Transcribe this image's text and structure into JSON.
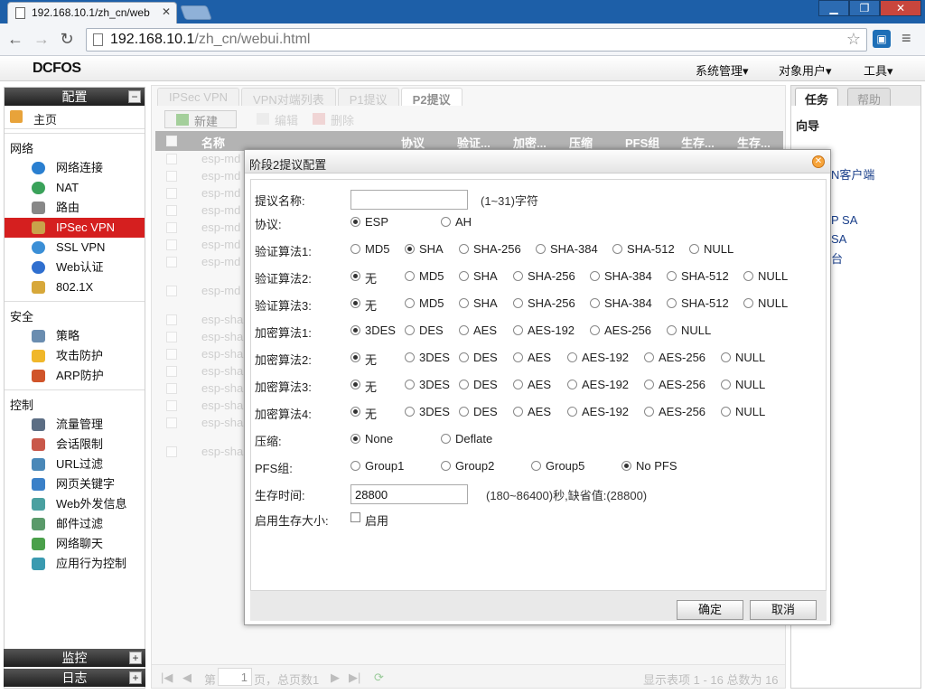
{
  "browser": {
    "tab_title": "192.168.10.1/zh_cn/web",
    "address_host": "192.168.10.1",
    "address_path": "/zh_cn/webui.html"
  },
  "app": {
    "logo": "DCFOS",
    "top_menu": [
      "系统管理▾",
      "对象用户▾",
      "工具▾"
    ]
  },
  "leftnav": {
    "header": "配置",
    "home": "主页",
    "sections": [
      {
        "title": "网络",
        "items": [
          "网络连接",
          "NAT",
          "路由",
          "IPSec VPN",
          "SSL VPN",
          "Web认证",
          "802.1X"
        ]
      },
      {
        "title": "安全",
        "items": [
          "策略",
          "攻击防护",
          "ARP防护"
        ]
      },
      {
        "title": "控制",
        "items": [
          "流量管理",
          "会话限制",
          "URL过滤",
          "网页关键字",
          "Web外发信息",
          "邮件过滤",
          "网络聊天",
          "应用行为控制"
        ]
      }
    ],
    "active_item": "IPSec VPN",
    "bottom": [
      "监控",
      "日志"
    ]
  },
  "main": {
    "tabs": [
      "IPSec VPN",
      "VPN对端列表",
      "P1提议",
      "P2提议"
    ],
    "active_tab": "P2提议",
    "actions": {
      "new": "新建",
      "edit": "编辑",
      "delete": "删除"
    },
    "columns": [
      "名称",
      "协议",
      "验证...",
      "加密...",
      "压缩",
      "PFS组",
      "生存...",
      "生存..."
    ],
    "rows": [
      "esp-md",
      "esp-md",
      "esp-md",
      "esp-md",
      "esp-md",
      "esp-md",
      "esp-md",
      "esp-md",
      "esp-sha",
      "esp-sha",
      "esp-sha",
      "esp-sha",
      "esp-sha",
      "esp-sha",
      "esp-sha",
      "esp-sha"
    ],
    "pager": {
      "prefix": "第",
      "page": "1",
      "suffix": "页，总页数1",
      "summary": "显示表项 1 - 16 总数为 16"
    }
  },
  "rightpanel": {
    "tabs": [
      "任务",
      "帮助"
    ],
    "title": "向导",
    "links": [
      "N客户端",
      "P SA",
      "SA",
      "台"
    ]
  },
  "dialog": {
    "title": "阶段2提议配置",
    "fields": {
      "name": {
        "label": "提议名称:",
        "value": "",
        "hint": "(1~31)字符"
      },
      "protocol": {
        "label": "协议:",
        "options": [
          "ESP",
          "AH"
        ],
        "selected": "ESP"
      },
      "auth1": {
        "label": "验证算法1:",
        "options": [
          "MD5",
          "SHA",
          "SHA-256",
          "SHA-384",
          "SHA-512",
          "NULL"
        ],
        "selected": "SHA"
      },
      "auth2": {
        "label": "验证算法2:",
        "options": [
          "无",
          "MD5",
          "SHA",
          "SHA-256",
          "SHA-384",
          "SHA-512",
          "NULL"
        ],
        "selected": "无"
      },
      "auth3": {
        "label": "验证算法3:",
        "options": [
          "无",
          "MD5",
          "SHA",
          "SHA-256",
          "SHA-384",
          "SHA-512",
          "NULL"
        ],
        "selected": "无"
      },
      "enc1": {
        "label": "加密算法1:",
        "options": [
          "3DES",
          "DES",
          "AES",
          "AES-192",
          "AES-256",
          "NULL"
        ],
        "selected": "3DES"
      },
      "enc2": {
        "label": "加密算法2:",
        "options": [
          "无",
          "3DES",
          "DES",
          "AES",
          "AES-192",
          "AES-256",
          "NULL"
        ],
        "selected": "无"
      },
      "enc3": {
        "label": "加密算法3:",
        "options": [
          "无",
          "3DES",
          "DES",
          "AES",
          "AES-192",
          "AES-256",
          "NULL"
        ],
        "selected": "无"
      },
      "enc4": {
        "label": "加密算法4:",
        "options": [
          "无",
          "3DES",
          "DES",
          "AES",
          "AES-192",
          "AES-256",
          "NULL"
        ],
        "selected": "无"
      },
      "compress": {
        "label": "压缩:",
        "options": [
          "None",
          "Deflate"
        ],
        "selected": "None"
      },
      "pfs": {
        "label": "PFS组:",
        "options": [
          "Group1",
          "Group2",
          "Group5",
          "No PFS"
        ],
        "selected": "No PFS"
      },
      "lifetime": {
        "label": "生存时间:",
        "value": "28800",
        "hint": "(180~86400)秒,缺省值:(28800)"
      },
      "lifesize": {
        "label": "启用生存大小:",
        "checkbox": "启用",
        "checked": false
      }
    },
    "ok": "确定",
    "cancel": "取消"
  }
}
